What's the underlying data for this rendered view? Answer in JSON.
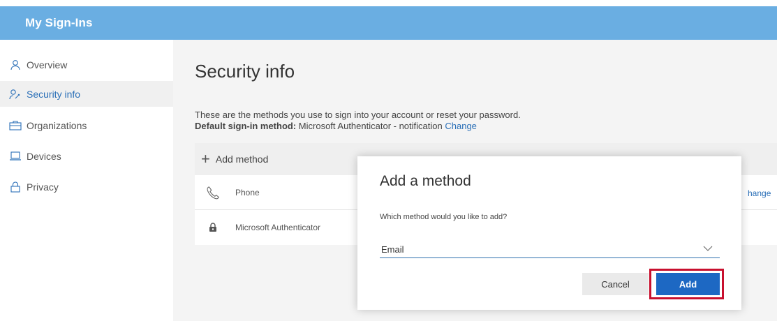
{
  "app": {
    "title": "My Sign-Ins"
  },
  "sidebar": {
    "items": [
      {
        "label": "Overview",
        "icon": "person-icon"
      },
      {
        "label": "Security info",
        "icon": "security-info-icon",
        "active": true
      },
      {
        "label": "Organizations",
        "icon": "briefcase-icon"
      },
      {
        "label": "Devices",
        "icon": "laptop-icon"
      },
      {
        "label": "Privacy",
        "icon": "lock-icon"
      }
    ]
  },
  "main": {
    "title": "Security info",
    "subtitle": "These are the methods you use to sign into your account or reset your password.",
    "default_method": {
      "label": "Default sign-in method:",
      "value": "Microsoft Authenticator - notification",
      "change": "Change"
    },
    "add_method_label": "Add method",
    "methods": [
      {
        "name": "Phone",
        "icon": "phone-icon",
        "action": "hange"
      },
      {
        "name": "Microsoft Authenticator",
        "icon": "authenticator-icon"
      }
    ]
  },
  "dialog": {
    "title": "Add a method",
    "question": "Which method would you like to add?",
    "select_value": "Email",
    "cancel_label": "Cancel",
    "add_label": "Add"
  },
  "colors": {
    "header_bg": "#6aaee2",
    "link": "#2a6fb7",
    "primary_button": "#1d68c3",
    "highlight_border": "#c8102e"
  }
}
